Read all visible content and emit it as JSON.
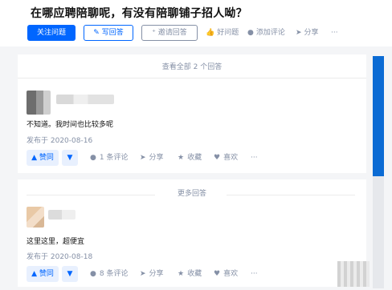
{
  "question": {
    "title": "在哪应聘陪聊呢，有没有陪聊铺子招人呦？"
  },
  "actions": {
    "follow": "关注问题",
    "answer": "写回答",
    "invite": "邀请回答",
    "good_question": "好问题",
    "add_comment": "添加评论",
    "share": "分享",
    "more": "···"
  },
  "answers_bar": {
    "view_all": "查看全部 2 个回答"
  },
  "answer1": {
    "text": "不知道。我时间也比较多呢",
    "date": "发布于 2020-08-16",
    "vote_up": "▲ 赞同",
    "vote_down": "▼",
    "comments": "1 条评论",
    "share": "分享",
    "collect": "收藏",
    "like": "喜欢",
    "more": "···"
  },
  "more_answers": {
    "label": "更多回答"
  },
  "answer2": {
    "text": "这里这里，超便宜",
    "date": "发布于 2020-08-18",
    "vote_up": "▲ 赞同",
    "vote_down": "▼",
    "comments": "8 条评论",
    "share": "分享",
    "collect": "收藏",
    "like": "喜欢",
    "more": "···"
  },
  "colors": {
    "primary": "#0066ff",
    "muted": "#8590a6",
    "scrollbar": "#0b6bd4"
  },
  "icons": {
    "answer": "pencil-icon",
    "invite": "person-add-icon",
    "good": "thumbs-up-icon",
    "comment": "comment-bubble-icon",
    "share": "paper-plane-icon",
    "collect": "star-icon",
    "like": "heart-icon"
  }
}
